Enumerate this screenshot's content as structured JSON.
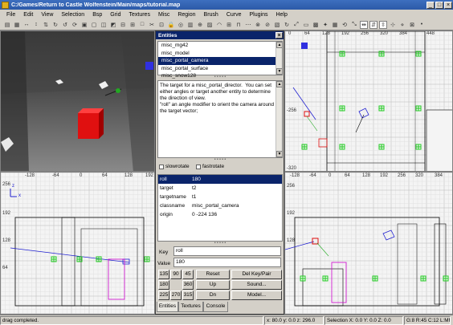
{
  "window": {
    "title": "C:/Games/Return to Castle Wolfenstein/Main/maps/tutorial.map"
  },
  "menu": [
    "File",
    "Edit",
    "View",
    "Selection",
    "Bsp",
    "Grid",
    "Textures",
    "Misc",
    "Region",
    "Brush",
    "Curve",
    "Plugins",
    "Help"
  ],
  "toolbar": {
    "icons": [
      "open-icon",
      "save-icon",
      "flip-x-icon",
      "flip-y-icon",
      "flip-z-icon",
      "rotate-x-icon",
      "rotate-y-icon",
      "rotate-z-icon",
      "select-complete-icon",
      "select-inside-icon",
      "select-touching-icon",
      "select-partial-icon",
      "csg-subtract-icon",
      "csg-merge-icon",
      "hollow-icon",
      "clipper-icon",
      "change-view-icon",
      "texture-lock-icon",
      "camera-movement-icon",
      "cubic-clip-icon",
      "entity-view-icon",
      "patch-icon",
      "bend-icon",
      "insert-icon",
      "cap-icon",
      "redisperse-icon",
      "weld-icon",
      "drill-icon",
      "show-patch-icon",
      "cycle-icon",
      "scale-icon",
      "fit-icon",
      "texture-icon",
      "lights-icon",
      "region-icon",
      "free-rotate-icon",
      "free-scale-icon",
      "scale-x-icon",
      "scale-y-icon",
      "scale-z-icon",
      "drag-edges-icon",
      "drag-vertices-icon",
      "lock-icon",
      "point-icon"
    ]
  },
  "entities": {
    "title": "Entities",
    "classes": [
      "misc_mg42",
      "misc_model",
      "misc_portal_camera",
      "misc_portal_surface",
      "misc_snow128"
    ],
    "selected_index": 2,
    "description": "The target for a misc_portal_director.  You can set either angles or target another entity to determine the direction of view.\n\"roll\" an angle modifier to orient the camera around the target vector;",
    "options": [
      "slowrotate",
      "fastrotate"
    ],
    "keyvalues": [
      {
        "key": "roll",
        "value": "180"
      },
      {
        "key": "target",
        "value": "t2"
      },
      {
        "key": "targetname",
        "value": "t1"
      },
      {
        "key": "classname",
        "value": "misc_portal_camera"
      },
      {
        "key": "origin",
        "value": "0 -224 136"
      }
    ],
    "key_label": "Key",
    "value_label": "Value",
    "key_value": "roll",
    "value_value": "180",
    "angles_row1": [
      "135",
      "90",
      "45"
    ],
    "angles_row2": [
      "180",
      "360"
    ],
    "angles_row3": [
      "225",
      "270",
      "315"
    ],
    "reset_label": "Reset",
    "up_label": "Up",
    "dn_label": "Dn",
    "del_label": "Del Key/Pair",
    "sound_label": "Sound...",
    "model_label": "Model...",
    "tabs": [
      "Entities",
      "Textures",
      "Console"
    ]
  },
  "views": {
    "top_ruler": [
      "0",
      "64",
      "128",
      "192",
      "256",
      "320",
      "384",
      "448"
    ],
    "top_ruler_side": [
      "-256",
      "-320"
    ],
    "bottom_ruler": [
      "-128",
      "-64",
      "0",
      "64",
      "128",
      "192"
    ],
    "bottom_side_ruler": [
      "256",
      "192",
      "128",
      "64"
    ],
    "right_ruler": [
      "-128",
      "-64",
      "0",
      "64",
      "128",
      "192",
      "256",
      "320",
      "384"
    ],
    "right_side_ruler": [
      "256",
      "192",
      "128"
    ],
    "axis_x": "x",
    "axis_y": "y",
    "axis_z": "z"
  },
  "status": {
    "message": "drag completed.",
    "coords": "x: 80.0  y: 0.0  z: 296.0",
    "selection": "Selection X: 0.0  Y: 0.0  Z: 0.0",
    "grid": "G:8 R:45 C:12 L:MR"
  },
  "colors": {
    "selection": "#0a246a",
    "titlebar": "#2c5aa8",
    "entity_red": "#e01010",
    "brush_green": "#22cc22",
    "path_blue": "#2020d0"
  }
}
